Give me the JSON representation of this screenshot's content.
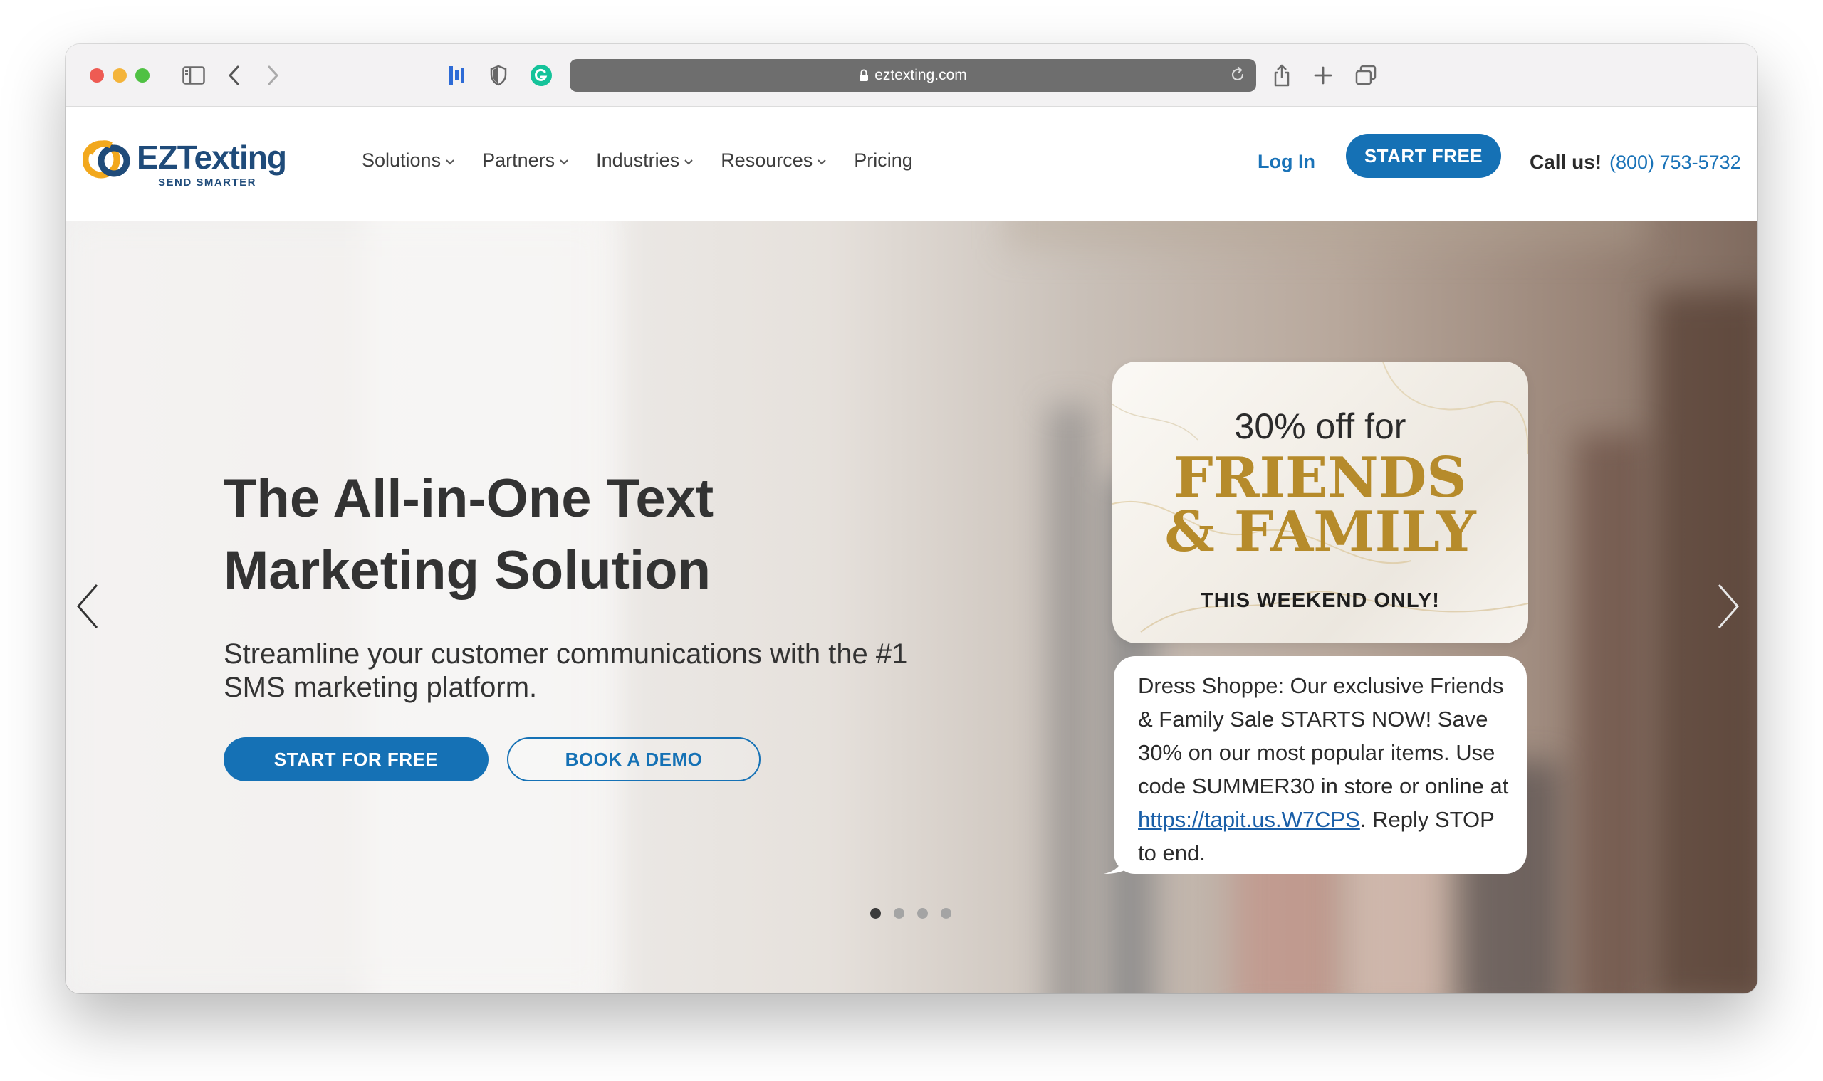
{
  "browser": {
    "url": "eztexting.com"
  },
  "logo": {
    "brand_ez": "EZ",
    "brand_texting": "Texting",
    "tagline": "SEND SMARTER",
    "accent_color": "#f2a81d",
    "brand_color": "#1f4b7a"
  },
  "nav": {
    "items": [
      {
        "label": "Solutions",
        "has_dropdown": true
      },
      {
        "label": "Partners",
        "has_dropdown": true
      },
      {
        "label": "Industries",
        "has_dropdown": true
      },
      {
        "label": "Resources",
        "has_dropdown": true
      },
      {
        "label": "Pricing",
        "has_dropdown": false
      }
    ],
    "login_label": "Log In",
    "start_free_label": "START FREE",
    "call_label": "Call us!",
    "phone": "(800) 753-5732"
  },
  "hero": {
    "title": "The All-in-One Text Marketing Solution",
    "subtitle": "Streamline your customer communications with the #1 SMS marketing platform.",
    "primary_cta": "START FOR FREE",
    "secondary_cta": "BOOK A DEMO",
    "slides": {
      "count": 4,
      "active": 1
    },
    "primary_color": "#1571b5"
  },
  "promo": {
    "line1": "30% off for",
    "line2a": "FRIENDS",
    "line2b": "& FAMILY",
    "line3": "THIS WEEKEND ONLY!",
    "gold_color": "#b68b2b"
  },
  "sms": {
    "text_before_link": "Dress Shoppe: Our exclusive Friends & Family Sale STARTS NOW! Save 30% on our most popular items. Use code SUMMER30 in store or online at ",
    "link": "https://tapit.us.W7CPS",
    "text_after_link": ". Reply STOP to end."
  }
}
